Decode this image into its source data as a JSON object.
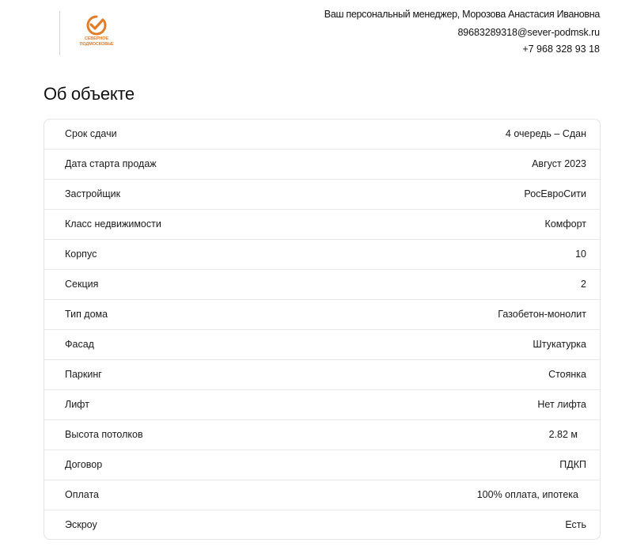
{
  "header": {
    "logo": {
      "text_line1": "СЕВЕРНОЕ",
      "text_line2": "ПОДМОСКОВЬЕ",
      "brand_color": "#e07d2a"
    },
    "manager": "Ваш персональный менеджер, Морозова Анастасия Ивановна",
    "email": "89683289318@sever-podmsk.ru",
    "phone": "+7 968 328 93 18"
  },
  "section_title": "Об объекте",
  "details": [
    {
      "label": "Срок сдачи",
      "value": "4 очередь – Сдан"
    },
    {
      "label": "Дата старта продаж",
      "value": "Август 2023"
    },
    {
      "label": "Застройщик",
      "value": "РосЕвроСити"
    },
    {
      "label": "Класс недвижимости",
      "value": "Комфорт"
    },
    {
      "label": "Корпус",
      "value": "10"
    },
    {
      "label": "Секция",
      "value": "2"
    },
    {
      "label": "Тип дома",
      "value": "Газобетон-монолит"
    },
    {
      "label": "Фасад",
      "value": "Штукатурка"
    },
    {
      "label": "Паркинг",
      "value": "Стоянка"
    },
    {
      "label": "Лифт",
      "value": "Нет лифта"
    },
    {
      "label": "Высота потолков",
      "value": "2.82 м"
    },
    {
      "label": "Договор",
      "value": "ПДКП"
    },
    {
      "label": "Оплата",
      "value": "100% оплата, ипотека"
    },
    {
      "label": "Эскроу",
      "value": "Есть"
    }
  ]
}
